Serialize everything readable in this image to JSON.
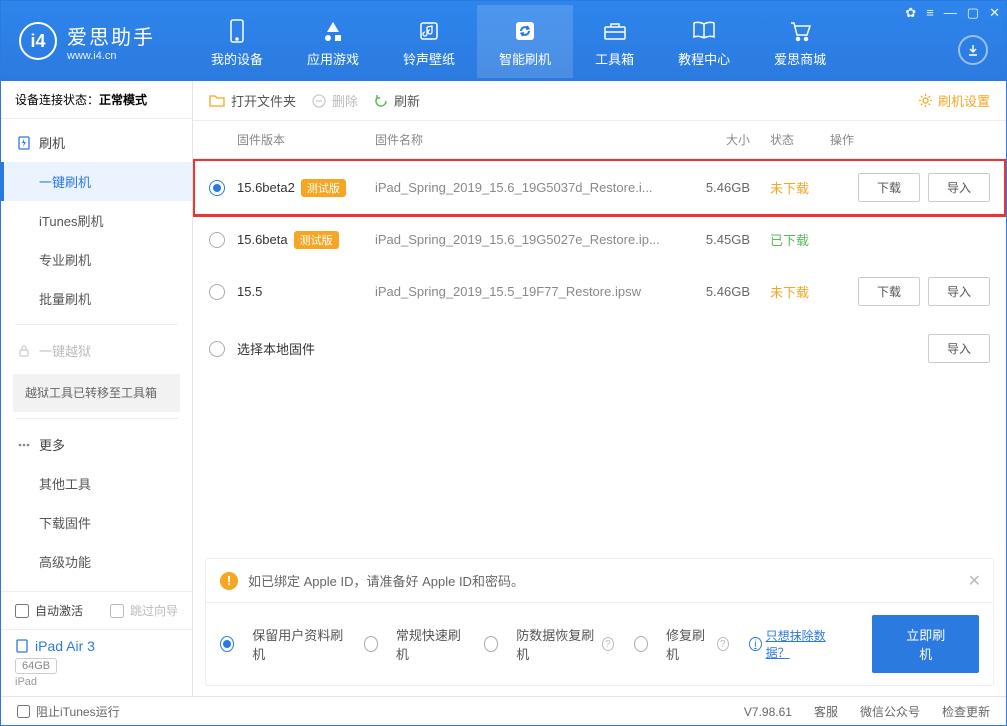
{
  "app": {
    "title": "爱思助手",
    "subtitle": "www.i4.cn"
  },
  "nav": {
    "items": [
      {
        "label": "我的设备"
      },
      {
        "label": "应用游戏"
      },
      {
        "label": "铃声壁纸"
      },
      {
        "label": "智能刷机"
      },
      {
        "label": "工具箱"
      },
      {
        "label": "教程中心"
      },
      {
        "label": "爱思商城"
      }
    ]
  },
  "sidebar": {
    "status_label": "设备连接状态：",
    "status_value": "正常模式",
    "flash_label": "刷机",
    "flash_items": [
      "一键刷机",
      "iTunes刷机",
      "专业刷机",
      "批量刷机"
    ],
    "jailbreak_label": "一键越狱",
    "jailbreak_note": "越狱工具已转移至工具箱",
    "more_label": "更多",
    "more_items": [
      "其他工具",
      "下载固件",
      "高级功能"
    ],
    "auto_activate": "自动激活",
    "skip_guide": "跳过向导",
    "device_name": "iPad Air 3",
    "device_capacity": "64GB",
    "device_type": "iPad"
  },
  "toolbar": {
    "open_folder": "打开文件夹",
    "delete": "删除",
    "refresh": "刷新",
    "settings": "刷机设置"
  },
  "table": {
    "headers": {
      "version": "固件版本",
      "name": "固件名称",
      "size": "大小",
      "status": "状态",
      "ops": "操作"
    },
    "beta_tag": "测试版",
    "download_btn": "下载",
    "import_btn": "导入",
    "local_row": "选择本地固件",
    "rows": [
      {
        "version": "15.6beta2",
        "beta": true,
        "name": "iPad_Spring_2019_15.6_19G5037d_Restore.i...",
        "size": "5.46GB",
        "status": "未下载",
        "status_class": "orange",
        "selected": true,
        "show_download": true
      },
      {
        "version": "15.6beta",
        "beta": true,
        "name": "iPad_Spring_2019_15.6_19G5027e_Restore.ip...",
        "size": "5.45GB",
        "status": "已下载",
        "status_class": "green",
        "selected": false,
        "show_download": false
      },
      {
        "version": "15.5",
        "beta": false,
        "name": "iPad_Spring_2019_15.5_19F77_Restore.ipsw",
        "size": "5.46GB",
        "status": "未下载",
        "status_class": "orange",
        "selected": false,
        "show_download": true
      }
    ]
  },
  "notice": {
    "warning": "如已绑定 Apple ID，请准备好 Apple ID和密码。",
    "options": [
      "保留用户资料刷机",
      "常规快速刷机",
      "防数据恢复刷机",
      "修复刷机"
    ],
    "erase_link": "只想抹除数据？",
    "flash_now": "立即刷机"
  },
  "footer": {
    "block_itunes": "阻止iTunes运行",
    "version": "V7.98.61",
    "support": "客服",
    "wechat": "微信公众号",
    "update": "检查更新"
  }
}
